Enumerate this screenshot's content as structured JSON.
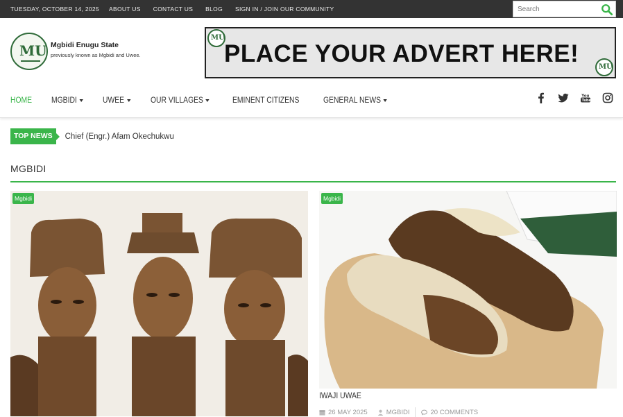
{
  "topbar": {
    "date": "TUESDAY, OCTOBER 14, 2025",
    "links": [
      "ABOUT US",
      "CONTACT US",
      "BLOG",
      "SIGN IN / JOIN OUR COMMUNITY"
    ],
    "search_placeholder": "Search"
  },
  "header": {
    "logo_title": "Mgbidi Enugu State",
    "logo_subtitle": "previously known as Mgbidi and Uwee.",
    "advert_text": "PLACE YOUR ADVERT HERE!"
  },
  "nav": {
    "items": [
      {
        "label": "HOME",
        "dropdown": false,
        "active": true
      },
      {
        "label": "MGBIDI",
        "dropdown": true
      },
      {
        "label": "UWEE",
        "dropdown": true
      },
      {
        "label": "OUR VILLAGES",
        "dropdown": true
      },
      {
        "label": "EMINENT CITIZENS",
        "dropdown": false
      },
      {
        "label": "GENERAL NEWS",
        "dropdown": true
      }
    ],
    "social": [
      "facebook-icon",
      "twitter-icon",
      "youtube-icon",
      "instagram-icon"
    ]
  },
  "top_news": {
    "label": "TOP NEWS",
    "headline": "Chief (Engr.) Afam Okechukwu"
  },
  "section": {
    "title": "MGBIDI"
  },
  "cards": [
    {
      "tag": "Mgbidi",
      "image": "carved-figures-photo"
    },
    {
      "tag": "Mgbidi",
      "image": "roasted-yam-photo",
      "title": "IWAJI UWAE",
      "date": "26 MAY 2025",
      "author": "MGBIDI",
      "comments": "20 COMMENTS"
    }
  ],
  "colors": {
    "accent": "#3ab54a",
    "topbar": "#333333",
    "logo_green": "#2f6b39"
  }
}
